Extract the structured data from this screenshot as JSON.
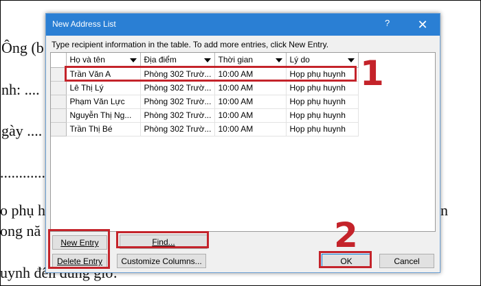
{
  "background_doc": {
    "lines": [
      "Ông (b",
      "nh: ....",
      "gày ....",
      "............",
      "o phụ h",
      "ong nă",
      "uynh đến đúng giờ.",
      "n"
    ]
  },
  "dialog": {
    "title": "New Address List",
    "help_label": "?",
    "close_label": "✕",
    "instruction": "Type recipient information in the table.  To add more entries, click New Entry.",
    "columns": [
      "Họ và tên",
      "Địa điểm",
      "Thời gian",
      "Lý do"
    ],
    "rows": [
      [
        "Trần Văn A",
        "Phòng 302 Trườ...",
        "10:00 AM",
        "Họp phụ huynh"
      ],
      [
        "Lê Thị Lý",
        "Phòng 302 Trườ...",
        "10:00 AM",
        "Họp phụ huynh"
      ],
      [
        "Phạm Văn Lực",
        "Phòng 302 Trườ...",
        "10:00 AM",
        "Họp phụ huynh"
      ],
      [
        "Nguyễn Thị Ng...",
        "Phòng 302 Trườ...",
        "10:00 AM",
        "Họp phụ huynh"
      ],
      [
        "Trần Thị Bé",
        "Phòng 302 Trườ...",
        "10:00 AM",
        "Họp phụ huynh"
      ]
    ],
    "buttons": {
      "new_entry": "New Entry",
      "delete_entry": "Delete Entry",
      "find": "Find...",
      "customize_columns": "Customize Columns...",
      "ok": "OK",
      "cancel": "Cancel"
    }
  },
  "annotations": {
    "step1": "1",
    "step2": "2",
    "highlight_color": "#c4232a"
  }
}
